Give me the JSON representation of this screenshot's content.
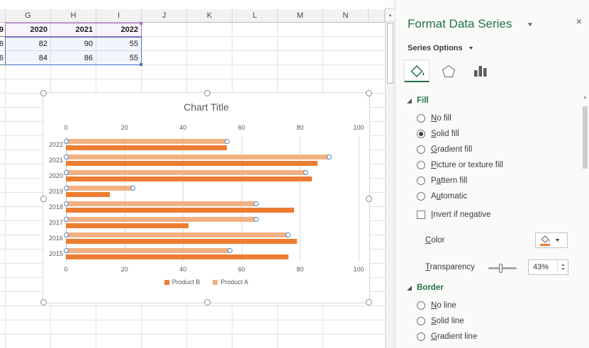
{
  "sheet": {
    "col_headers": [
      "G",
      "H",
      "I",
      "J",
      "K",
      "L",
      "M",
      "N"
    ],
    "rows": [
      {
        "partial": "9",
        "cells": [
          "2020",
          "2021",
          "2022"
        ],
        "bold": true
      },
      {
        "partial": "8",
        "cells": [
          "82",
          "90",
          "55"
        ],
        "bold": false
      },
      {
        "partial": "6",
        "cells": [
          "84",
          "86",
          "55"
        ],
        "bold": false
      }
    ]
  },
  "chart_data": {
    "type": "bar",
    "orientation": "horizontal",
    "title": "Chart Title",
    "categories": [
      "2022",
      "2021",
      "2020",
      "2019",
      "2018",
      "2017",
      "2016",
      "2015"
    ],
    "series": [
      {
        "name": "Product B",
        "color": "#ED7D31",
        "selected": false,
        "values": [
          55,
          86,
          84,
          15,
          78,
          42,
          79,
          76
        ]
      },
      {
        "name": "Product A",
        "color": "#F2B183",
        "selected": true,
        "values": [
          55,
          90,
          82,
          23,
          65,
          65,
          76,
          56
        ]
      }
    ],
    "x_axis": {
      "min": 0,
      "max": 100,
      "ticks": [
        0,
        20,
        40,
        60,
        80,
        100
      ],
      "position": "top-and-bottom"
    },
    "legend": {
      "position": "bottom",
      "entries": [
        "Product B",
        "Product A"
      ]
    },
    "gridlines": true,
    "selected_series": "Product A"
  },
  "pane": {
    "title": "Format Data Series",
    "subtitle": "Series Options",
    "tabs": [
      {
        "icon": "paint-bucket-icon",
        "selected": true
      },
      {
        "icon": "pentagon-icon",
        "selected": false
      },
      {
        "icon": "bar-chart-icon",
        "selected": false
      }
    ],
    "fill": {
      "header": "Fill",
      "options": [
        {
          "name": "no-fill",
          "pre": "",
          "accel": "N",
          "post": "o fill",
          "selected": false
        },
        {
          "name": "solid-fill",
          "pre": "",
          "accel": "S",
          "post": "olid fill",
          "selected": true
        },
        {
          "name": "gradient-fill",
          "pre": "",
          "accel": "G",
          "post": "radient fill",
          "selected": false
        },
        {
          "name": "picture-or-texture-fill",
          "pre": "",
          "accel": "P",
          "post": "icture or texture fill",
          "selected": false
        },
        {
          "name": "pattern-fill",
          "pre": "P",
          "accel": "a",
          "post": "ttern fill",
          "selected": false
        },
        {
          "name": "automatic",
          "pre": "A",
          "accel": "u",
          "post": "tomatic",
          "selected": false
        }
      ],
      "invert": {
        "pre": "",
        "accel": "I",
        "post": "nvert if negative",
        "checked": false
      },
      "color_label": {
        "pre": "",
        "accel": "C",
        "post": "olor"
      },
      "transparency_label": {
        "pre": "",
        "accel": "T",
        "post": "ransparency"
      },
      "transparency_value": "43%",
      "transparency_percent": 43
    },
    "border": {
      "header": "Border",
      "options": [
        {
          "name": "no-line",
          "pre": "",
          "accel": "N",
          "post": "o line",
          "selected": false
        },
        {
          "name": "solid-line",
          "pre": "",
          "accel": "S",
          "post": "olid line",
          "selected": false
        },
        {
          "name": "gradient-line",
          "pre": "",
          "accel": "G",
          "post": "radient line",
          "selected": false
        }
      ]
    }
  },
  "icons": {
    "title_caret": "▼",
    "close": "×",
    "series_options_caret": "▼",
    "scroll_up": "▲",
    "spinner_up": "▲",
    "spinner_down": "▼",
    "color_caret": "▼"
  },
  "colors": {
    "accent_green": "#217346",
    "bar_orange": "#ED7D31",
    "bar_orange_light": "#F2B183",
    "range_purple": "#A36FC6",
    "range_blue": "#4472C4"
  }
}
